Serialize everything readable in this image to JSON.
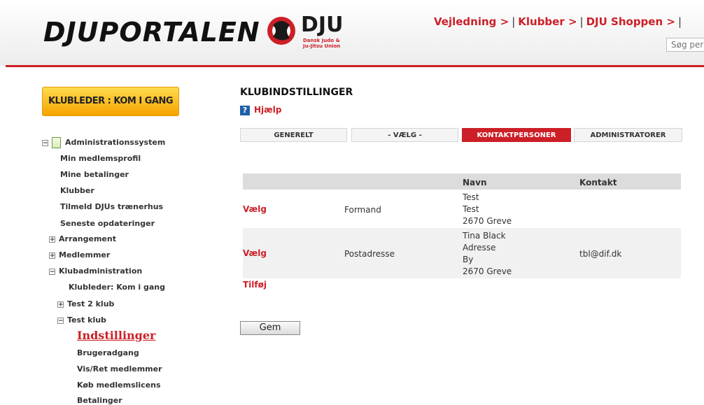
{
  "header": {
    "portal_logo": "DJUPORTALEN",
    "dju_logo": "DJU",
    "dju_sub1": "Dansk Judo &",
    "dju_sub2": "Ju-Jitsu Union",
    "nav": [
      "Vejledning >",
      "Klubber >",
      "DJU Shoppen >"
    ],
    "nav_tail": "|",
    "search_placeholder": "Søg per"
  },
  "sidebar": {
    "start_button": "KLUBLEDER : KOM I GANG",
    "root": "Administrationssystem",
    "items": [
      "Min medlemsprofil",
      "Mine betalinger",
      "Klubber",
      "Tilmeld DJUs trænerhus",
      "Seneste opdateringer"
    ],
    "arrangement": "Arrangement",
    "medlemmer": "Medlemmer",
    "klubadministration": "Klubadministration",
    "klubleder": "Klubleder: Kom i gang",
    "test2": "Test 2 klub",
    "testklub": "Test klub",
    "active": "Indstillinger",
    "sub": [
      "Brugeradgang",
      "Vis/Ret medlemmer",
      "Køb medlemslicens",
      "Betalinger"
    ]
  },
  "main": {
    "title": "KLUBINDSTILLINGER",
    "help": "Hjælp",
    "tabs": [
      "GENERELT",
      "- VÆLG -",
      "KONTAKTPERSONER",
      "ADMINISTRATORER"
    ],
    "col_navn": "Navn",
    "col_kontakt": "Kontakt",
    "rows": [
      {
        "action": "Vælg",
        "role": "Formand",
        "navn": [
          "Test",
          "Test",
          "2670 Greve"
        ],
        "kontakt": ""
      },
      {
        "action": "Vælg",
        "role": "Postadresse",
        "navn": [
          "Tina Black",
          "Adresse",
          "By",
          "2670 Greve"
        ],
        "kontakt": "tbl@dif.dk"
      }
    ],
    "add": "Tilføj",
    "save": "Gem"
  },
  "colors": {
    "accent": "#cc1f27",
    "button_yellow": "#f5a300"
  }
}
